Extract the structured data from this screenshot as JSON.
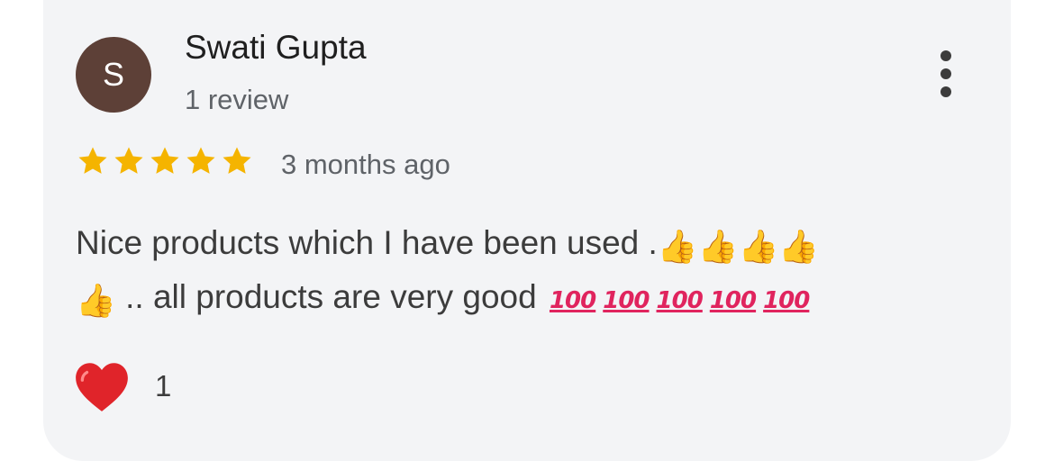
{
  "review": {
    "author_initial": "S",
    "author_name": "Swati Gupta",
    "author_review_count": "1 review",
    "rating": 5,
    "rating_max": 5,
    "time_ago": "3 months ago",
    "text_part1": "Nice products which I have been used .",
    "text_part2": " .. all products are very good ",
    "reaction_count": "1",
    "emoji_100": "100"
  },
  "colors": {
    "avatar_bg": "#5d4037",
    "star": "#f5b400",
    "heart": "#e0242a",
    "card_bg": "#f3f4f6"
  },
  "icons": {
    "menu": "more-vertical-icon",
    "thumb": "thumbs-up-icon",
    "hundred": "hundred-points-icon",
    "heart": "heart-icon",
    "star": "star-icon"
  }
}
